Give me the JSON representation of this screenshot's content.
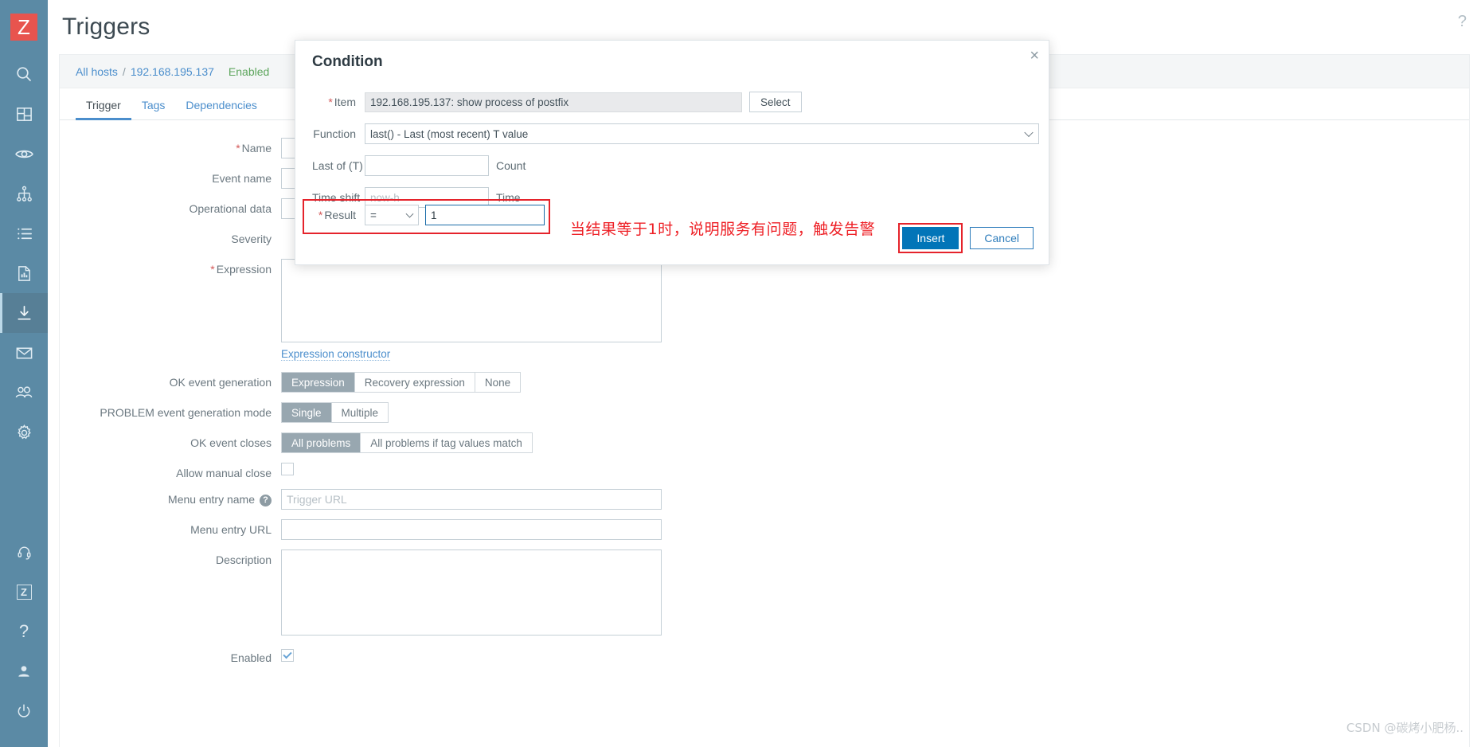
{
  "sidebar": {
    "logo_text": "Z",
    "top_items": [
      {
        "name": "search-icon",
        "label": "Search"
      },
      {
        "name": "dashboard-icon",
        "label": "Dashboards"
      },
      {
        "name": "monitoring-eye-icon",
        "label": "Monitoring"
      },
      {
        "name": "services-tree-icon",
        "label": "Services"
      },
      {
        "name": "inventory-list-icon",
        "label": "Inventory"
      },
      {
        "name": "reports-chart-icon",
        "label": "Reports"
      },
      {
        "name": "data-collection-icon",
        "label": "Data collection",
        "active": true
      },
      {
        "name": "alerts-mail-icon",
        "label": "Alerts"
      },
      {
        "name": "users-icon",
        "label": "Users"
      },
      {
        "name": "administration-gear-icon",
        "label": "Administration"
      }
    ],
    "bottom_items": [
      {
        "name": "support-headset-icon",
        "label": "Support"
      },
      {
        "name": "zabbix-integrations-icon",
        "label": "Integrations"
      },
      {
        "name": "help-question-icon",
        "label": "Help"
      },
      {
        "name": "user-profile-icon",
        "label": "User settings"
      },
      {
        "name": "sign-out-power-icon",
        "label": "Sign out"
      }
    ]
  },
  "header": {
    "title": "Triggers",
    "help_icon": "?"
  },
  "breadcrumb": {
    "all_hosts": "All hosts",
    "separator": "/",
    "host": "192.168.195.137",
    "status": "Enabled"
  },
  "tabs": [
    {
      "label": "Trigger",
      "active": true
    },
    {
      "label": "Tags",
      "active": false
    },
    {
      "label": "Dependencies",
      "active": false
    }
  ],
  "form": {
    "name_label": "Name",
    "name_value": "",
    "event_name_label": "Event name",
    "event_name_value": "",
    "operational_data_label": "Operational data",
    "operational_data_value": "",
    "severity_label": "Severity",
    "expression_label": "Expression",
    "expression_value": "",
    "expression_constructor": "Expression constructor",
    "ok_event_generation_label": "OK event generation",
    "ok_event_generation_options": [
      {
        "label": "Expression",
        "selected": true
      },
      {
        "label": "Recovery expression",
        "selected": false
      },
      {
        "label": "None",
        "selected": false
      }
    ],
    "problem_event_mode_label": "PROBLEM event generation mode",
    "problem_event_mode_options": [
      {
        "label": "Single",
        "selected": true
      },
      {
        "label": "Multiple",
        "selected": false
      }
    ],
    "ok_event_closes_label": "OK event closes",
    "ok_event_closes_options": [
      {
        "label": "All problems",
        "selected": true
      },
      {
        "label": "All problems if tag values match",
        "selected": false
      }
    ],
    "allow_manual_close_label": "Allow manual close",
    "allow_manual_close_checked": false,
    "menu_entry_name_label": "Menu entry name",
    "menu_entry_name_placeholder": "Trigger URL",
    "menu_entry_name_value": "",
    "menu_entry_url_label": "Menu entry URL",
    "menu_entry_url_value": "",
    "description_label": "Description",
    "description_value": "",
    "enabled_label": "Enabled",
    "enabled_checked": true
  },
  "modal": {
    "title": "Condition",
    "close_icon": "×",
    "item_label": "Item",
    "item_required": "*",
    "item_value": "192.168.195.137: show process of postfix",
    "select_button": "Select",
    "function_label": "Function",
    "function_value": "last() - Last (most recent) T value",
    "last_of_t_label": "Last of (T)",
    "last_of_t_value": "",
    "last_of_t_unit": "Count",
    "time_shift_label": "Time shift",
    "time_shift_placeholder": "now-h",
    "time_shift_value": "",
    "time_shift_unit": "Time",
    "result_label": "Result",
    "result_required": "*",
    "result_operator": "=",
    "result_value": "1",
    "insert_button": "Insert",
    "cancel_button": "Cancel"
  },
  "annotation": {
    "text": "当结果等于1时，说明服务有问题，触发告警",
    "color": "#ee1f25"
  },
  "watermark": {
    "text": "CSDN @碳烤小肥杨.."
  },
  "colors": {
    "sidebar_bg": "#5b8aa5",
    "logo_red": "#e8544e",
    "link_blue": "#4b8ecc",
    "primary_blue": "#0275b8",
    "enabled_green": "#5ea65e",
    "highlight_red": "#e5232b",
    "segment_active": "#98a7b0"
  }
}
